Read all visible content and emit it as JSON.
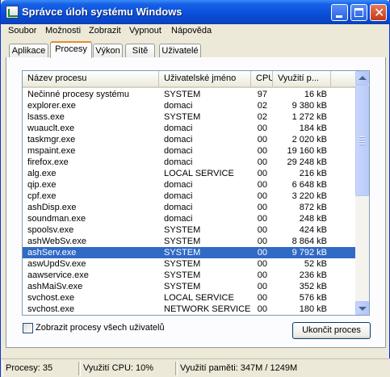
{
  "window": {
    "title": "Správce úloh systému Windows"
  },
  "menu": [
    "Soubor",
    "Možnosti",
    "Zobrazit",
    "Vypnout",
    "Nápověda"
  ],
  "tabs": [
    "Aplikace",
    "Procesy",
    "Výkon",
    "Sítě",
    "Uživatelé"
  ],
  "active_tab": "Procesy",
  "columns": [
    "Název procesu",
    "Uživatelské jméno",
    "CPU",
    "Využití p..."
  ],
  "processes": [
    {
      "name": "Nečinné procesy systému",
      "user": "SYSTEM",
      "cpu": "97",
      "mem": "16 kB"
    },
    {
      "name": "explorer.exe",
      "user": "domaci",
      "cpu": "02",
      "mem": "9 380 kB"
    },
    {
      "name": "lsass.exe",
      "user": "SYSTEM",
      "cpu": "02",
      "mem": "1 272 kB"
    },
    {
      "name": "wuauclt.exe",
      "user": "domaci",
      "cpu": "00",
      "mem": "184 kB"
    },
    {
      "name": "taskmgr.exe",
      "user": "domaci",
      "cpu": "00",
      "mem": "2 020 kB"
    },
    {
      "name": "mspaint.exe",
      "user": "domaci",
      "cpu": "00",
      "mem": "19 160 kB"
    },
    {
      "name": "firefox.exe",
      "user": "domaci",
      "cpu": "00",
      "mem": "29 248 kB"
    },
    {
      "name": "alg.exe",
      "user": "LOCAL SERVICE",
      "cpu": "00",
      "mem": "216 kB"
    },
    {
      "name": "qip.exe",
      "user": "domaci",
      "cpu": "00",
      "mem": "6 648 kB"
    },
    {
      "name": "cpf.exe",
      "user": "domaci",
      "cpu": "00",
      "mem": "3 220 kB"
    },
    {
      "name": "ashDisp.exe",
      "user": "domaci",
      "cpu": "00",
      "mem": "872 kB"
    },
    {
      "name": "soundman.exe",
      "user": "domaci",
      "cpu": "00",
      "mem": "248 kB"
    },
    {
      "name": "spoolsv.exe",
      "user": "SYSTEM",
      "cpu": "00",
      "mem": "424 kB"
    },
    {
      "name": "ashWebSv.exe",
      "user": "SYSTEM",
      "cpu": "00",
      "mem": "8 864 kB"
    },
    {
      "name": "ashServ.exe",
      "user": "SYSTEM",
      "cpu": "00",
      "mem": "9 792 kB"
    },
    {
      "name": "aswUpdSv.exe",
      "user": "SYSTEM",
      "cpu": "00",
      "mem": "52 kB"
    },
    {
      "name": "aawservice.exe",
      "user": "SYSTEM",
      "cpu": "00",
      "mem": "236 kB"
    },
    {
      "name": "ashMaiSv.exe",
      "user": "SYSTEM",
      "cpu": "00",
      "mem": "352 kB"
    },
    {
      "name": "svchost.exe",
      "user": "LOCAL SERVICE",
      "cpu": "00",
      "mem": "576 kB"
    },
    {
      "name": "svchost.exe",
      "user": "NETWORK SERVICE",
      "cpu": "00",
      "mem": "180 kB"
    }
  ],
  "selected_process": "ashServ.exe",
  "show_all_users_label": "Zobrazit procesy všech uživatelů",
  "show_all_users_checked": false,
  "end_process_label": "Ukončit proces",
  "status": {
    "processes": "Procesy: 35",
    "cpu": "Využití CPU: 10%",
    "memory": "Využití paměti: 347M / 1249M"
  },
  "colors": {
    "titlebar": "#0A4ED8",
    "selection": "#316AC5",
    "active_tab_accent": "#E68B2C",
    "face": "#ECE9D8"
  }
}
